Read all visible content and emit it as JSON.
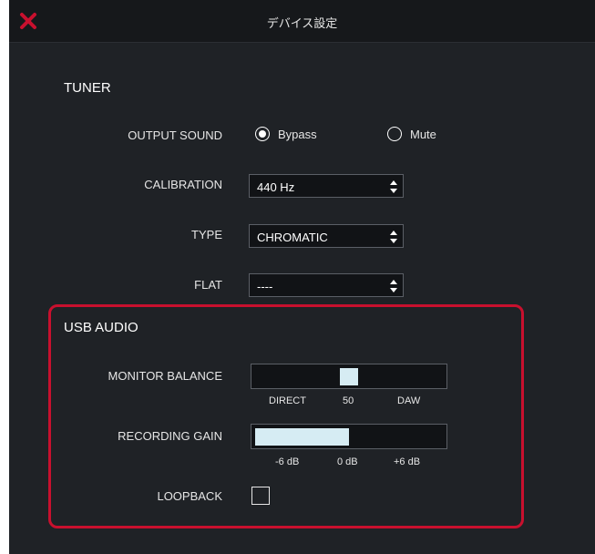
{
  "window": {
    "title": "デバイス設定",
    "close_icon": "close-x-icon",
    "accent_color": "#c8102e"
  },
  "tuner": {
    "section_title": "TUNER",
    "output_sound": {
      "label": "OUTPUT SOUND",
      "options": [
        "Bypass",
        "Mute"
      ],
      "selected": "Bypass"
    },
    "calibration": {
      "label": "CALIBRATION",
      "value": "440 Hz"
    },
    "type": {
      "label": "TYPE",
      "value": "CHROMATIC"
    },
    "flat": {
      "label": "FLAT",
      "value": "----"
    }
  },
  "usb_audio": {
    "section_title": "USB AUDIO",
    "monitor_balance": {
      "label": "MONITOR BALANCE",
      "value": 50,
      "scale": [
        "DIRECT",
        "50",
        "DAW"
      ]
    },
    "recording_gain": {
      "label": "RECORDING GAIN",
      "fill_fraction": 0.5,
      "scale": [
        "-6 dB",
        "0 dB",
        "+6 dB"
      ]
    },
    "loopback": {
      "label": "LOOPBACK",
      "checked": false
    }
  }
}
